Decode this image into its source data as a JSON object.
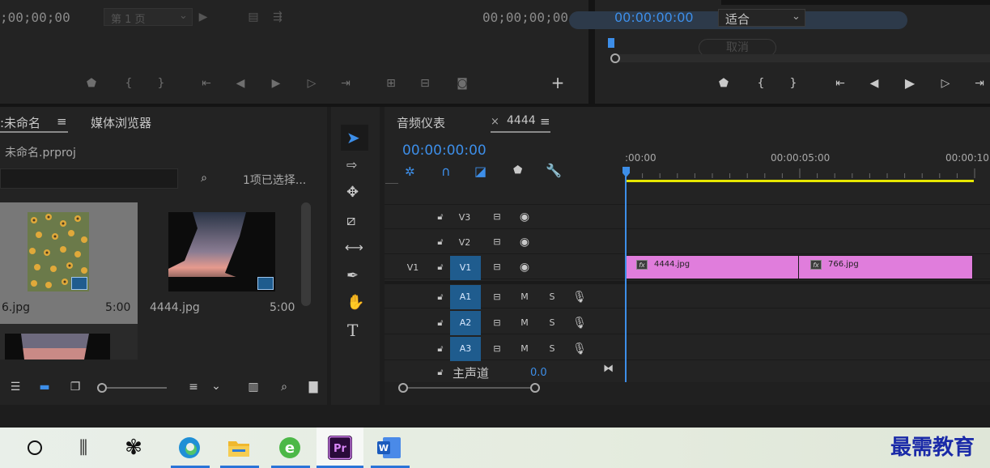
{
  "source_monitor": {
    "timecode_left": ";00;00;00",
    "page_select": "第 1 页",
    "timecode_right": "00;00;00;00"
  },
  "program_monitor": {
    "timecode": "00:00:00:00",
    "fit_label": "适合",
    "cancel_label": "取消"
  },
  "project_panel": {
    "tab_label": ":未命名",
    "media_browser_tab": "媒体浏览器",
    "project_file": "未命名.prproj",
    "selection_status": "1项已选择...",
    "items": [
      {
        "name": "6.jpg",
        "duration": "5:00"
      },
      {
        "name": "4444.jpg",
        "duration": "5:00"
      }
    ]
  },
  "timeline": {
    "audio_meter_tab": "音频仪表",
    "sequence_tab": "4444",
    "timecode": "00:00:00:00",
    "ruler_labels": [
      ":00:00",
      "00:00:05:00",
      "00:00:10"
    ],
    "tracks": {
      "v3": "V3",
      "v2": "V2",
      "v1_source": "V1",
      "v1": "V1",
      "a1": "A1",
      "a2": "A2",
      "a3": "A3",
      "mute": "M",
      "solo": "S"
    },
    "master_label": "主声道",
    "master_value": "0.0",
    "clips": [
      {
        "name": "4444.jpg"
      },
      {
        "name": "766.jpg"
      }
    ]
  },
  "taskbar": {
    "watermark": "最需教育"
  },
  "colors": {
    "accent_blue": "#3d8ee8",
    "clip_pink": "#e07ddc",
    "work_area_yellow": "#e6e600",
    "target_blue": "#1f5c8e"
  }
}
